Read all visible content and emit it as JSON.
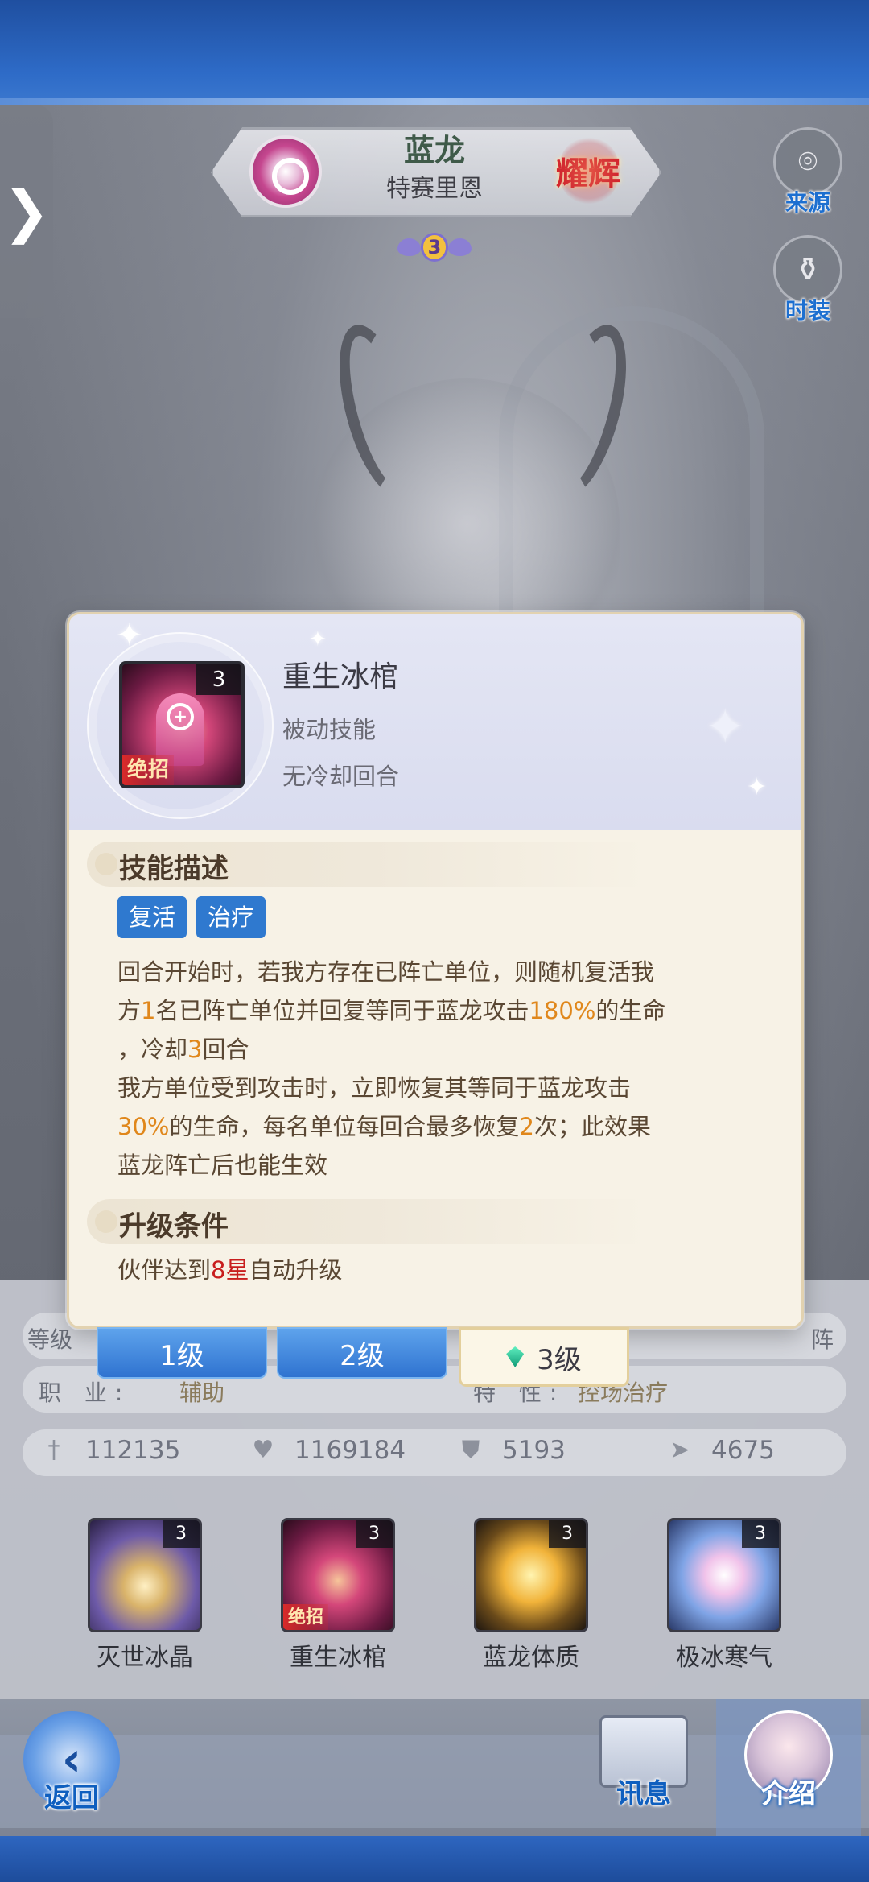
{
  "hero": {
    "name": "蓝龙",
    "title": "特赛里恩",
    "rank_badge": "耀辉",
    "star_count": "3"
  },
  "side_buttons": {
    "source_label": "来源",
    "outfit_label": "时装"
  },
  "drawer": {
    "arrow": "❯"
  },
  "skill_popup": {
    "icon_level": "3",
    "icon_tag": "绝招",
    "name": "重生冰棺",
    "type": "被动技能",
    "cooldown": "无冷却回合",
    "description_header": "技能描述",
    "tags": [
      "复活",
      "治疗"
    ],
    "description_lines": [
      [
        "回合开始时，若我方存在已阵亡单位，则随机复活我"
      ],
      [
        "方",
        {
          "hl": "1"
        },
        "名已阵亡单位并回复等同于蓝龙攻击",
        {
          "hl": "180%"
        },
        "的生命"
      ],
      [
        "，冷却",
        {
          "hl": "3"
        },
        "回合"
      ],
      [
        "我方单位受到攻击时，立即恢复其等同于蓝龙攻击"
      ],
      [
        {
          "hl": "30%"
        },
        "的生命，每名单位每回合最多恢复",
        {
          "hl": "2"
        },
        "次；此效果"
      ],
      [
        "蓝龙阵亡后也能生效"
      ]
    ],
    "upgrade_header": "升级条件",
    "upgrade_prefix": "伙伴达到",
    "upgrade_highlight": "8星",
    "upgrade_suffix": "自动升级"
  },
  "level_tabs": [
    {
      "label": "1级",
      "active": false
    },
    {
      "label": "2级",
      "active": false
    },
    {
      "label": "3级",
      "active": true
    }
  ],
  "info_panel": {
    "level_label": "等级",
    "level_right": "阵",
    "job_label": "职 业:",
    "job_value": "辅助",
    "trait_label": "特 性:",
    "trait_value": "控场治疗",
    "stats": [
      {
        "icon": "sword-icon",
        "glyph": "†",
        "value": "112135"
      },
      {
        "icon": "heart-icon",
        "glyph": "♥",
        "value": "1169184"
      },
      {
        "icon": "shield-icon",
        "glyph": "⛊",
        "value": "5193"
      },
      {
        "icon": "boot-icon",
        "glyph": "➤",
        "value": "4675"
      }
    ]
  },
  "skills": [
    {
      "name": "灭世冰晶",
      "level": "3",
      "ult": ""
    },
    {
      "name": "重生冰棺",
      "level": "3",
      "ult": "绝招"
    },
    {
      "name": "蓝龙体质",
      "level": "3",
      "ult": ""
    },
    {
      "name": "极冰寒气",
      "level": "3",
      "ult": ""
    }
  ],
  "bottom_nav": {
    "back_label": "返回",
    "info_label": "讯息",
    "intro_label": "介绍"
  },
  "colors": {
    "highlight": "#e0871b",
    "star_red": "#c81e1e",
    "tag_blue": "#2f79cf",
    "tab_blue": "#2f73d0"
  }
}
